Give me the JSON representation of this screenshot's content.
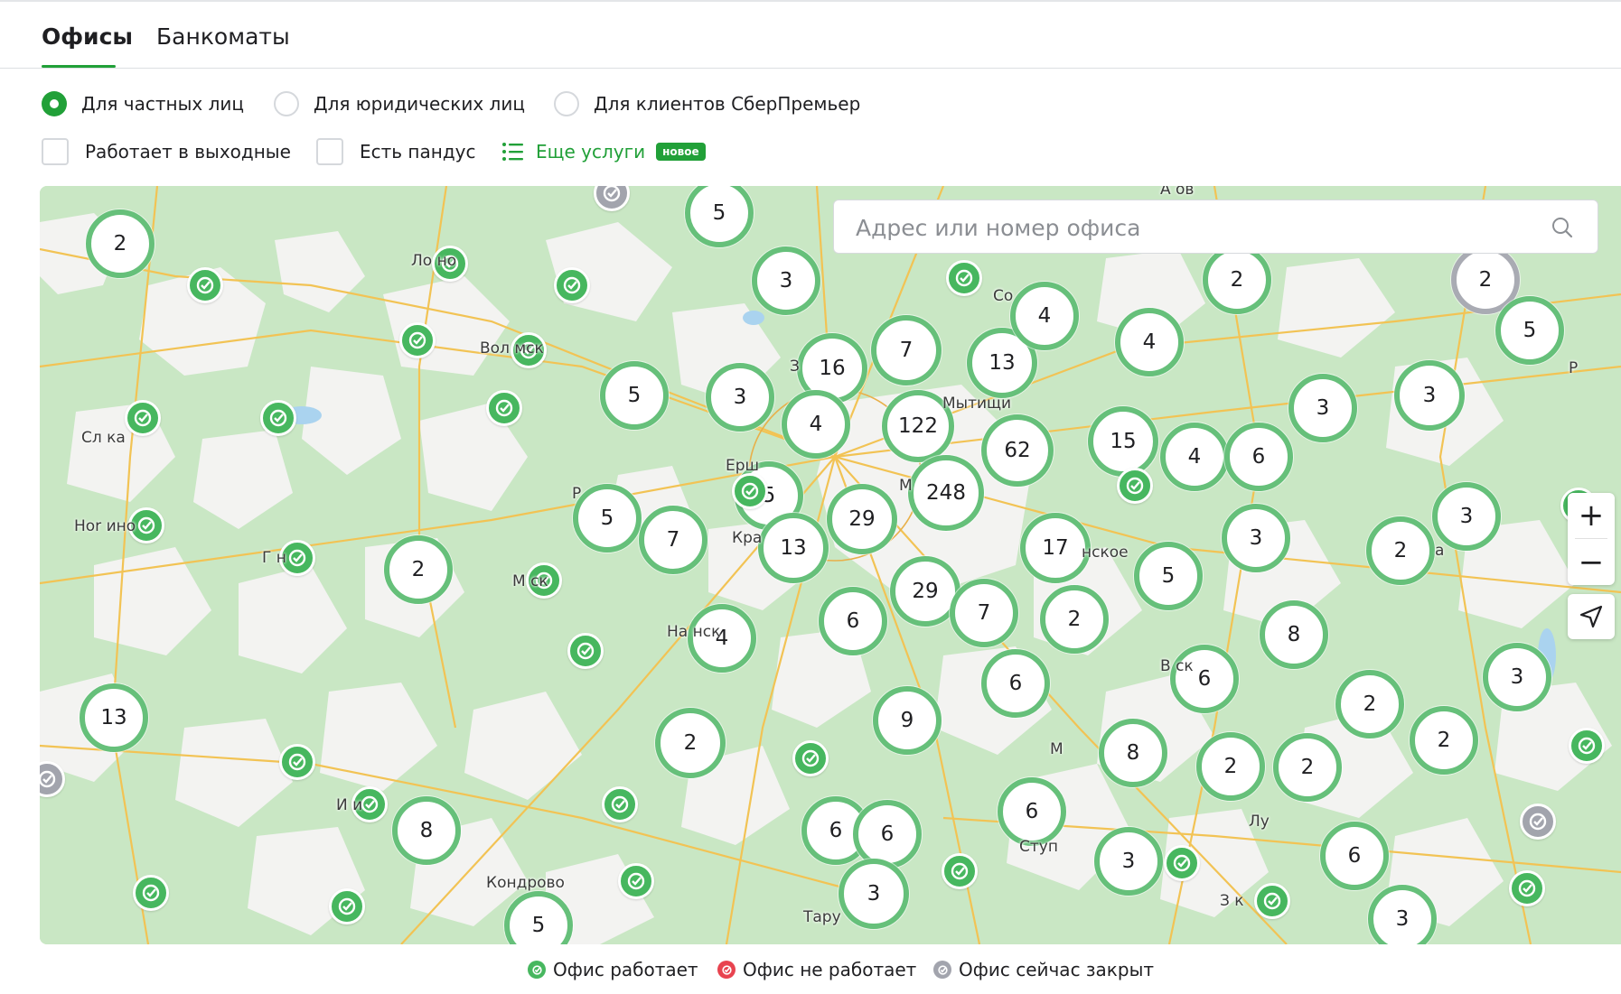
{
  "tabs": [
    {
      "label": "Офисы",
      "active": true
    },
    {
      "label": "Банкоматы",
      "active": false
    }
  ],
  "client_types": [
    {
      "label": "Для частных лиц",
      "selected": true
    },
    {
      "label": "Для юридических лиц",
      "selected": false
    },
    {
      "label": "Для клиентов СберПремьер",
      "selected": false
    }
  ],
  "filters": {
    "weekends_label": "Работает в выходные",
    "weekends_checked": false,
    "ramp_label": "Есть пандус",
    "ramp_checked": false,
    "more_services_label": "Еще услуги",
    "new_badge": "новое"
  },
  "search": {
    "placeholder": "Адрес или номер офиса",
    "value": ""
  },
  "map": {
    "zoom_in": "+",
    "zoom_out": "−",
    "clusters": [
      "2",
      "5",
      "3",
      "16",
      "7",
      "13",
      "4",
      "4",
      "2",
      "2",
      "5",
      "5",
      "3",
      "4",
      "122",
      "62",
      "15",
      "4",
      "6",
      "3",
      "3",
      "5",
      "5",
      "7",
      "248",
      "29",
      "13",
      "17",
      "3",
      "3",
      "2",
      "2",
      "29",
      "6",
      "7",
      "2",
      "5",
      "8",
      "4",
      "6",
      "9",
      "6",
      "3",
      "2",
      "13",
      "2",
      "8",
      "2",
      "2",
      "8",
      "6",
      "2",
      "6",
      "6",
      "3",
      "3",
      "6",
      "3",
      "5"
    ],
    "towns": [
      "Ло но",
      "Вол мск",
      "Со",
      "З",
      "Мытищи",
      "Сл ка",
      "Ерш",
      "М",
      "Ноr ино",
      "Г н",
      "Кра",
      "М ск",
      "На нск",
      "Р",
      "нское",
      "В ск",
      "М",
      "И и",
      "Кондрово",
      "Тару",
      "Ступ",
      "Лу",
      "З к",
      "А ов",
      "Р",
      "а"
    ]
  },
  "legend": [
    {
      "label": "Офис работает",
      "color": "#47b75f"
    },
    {
      "label": "Офис не работает",
      "color": "#e8434f"
    },
    {
      "label": "Офис сейчас закрыт",
      "color": "#a2a4ad"
    }
  ],
  "colors": {
    "accent": "#21a038",
    "cluster_border": "#66c07a",
    "map_green": "#c8e6c3"
  }
}
